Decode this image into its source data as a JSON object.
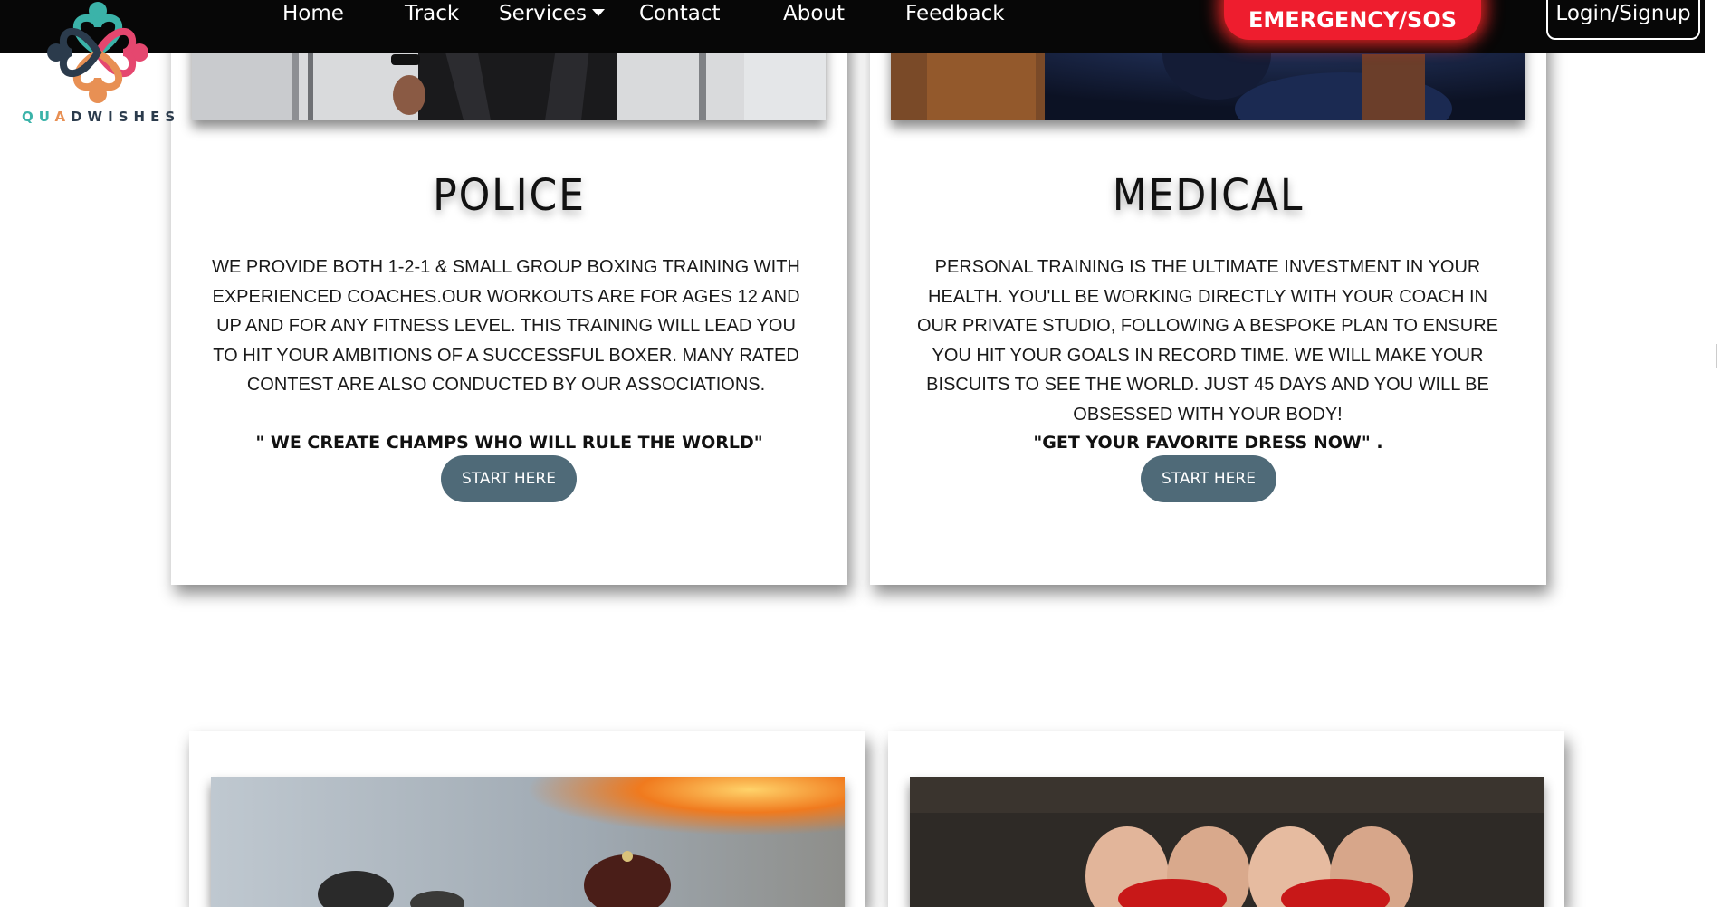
{
  "nav": {
    "items": [
      "Home",
      "Track",
      "Services",
      "Contact",
      "About",
      "Feedback"
    ],
    "sos_label": "EMERGENCY/SOS",
    "login_label": "Login/Signup"
  },
  "logo": {
    "letters": [
      "Q",
      "U",
      "A",
      "D",
      "W",
      "I",
      "S",
      "H",
      "E",
      "S"
    ],
    "letter_colors": [
      "#3bb3a9",
      "#3bb3a9",
      "#e89054",
      "#2b3b4c",
      "#2b3b4c",
      "#2b3b4c",
      "#2b3b4c",
      "#2b3b4c",
      "#2b3b4c",
      "#2b3b4c"
    ],
    "petal_colors": {
      "teal": "#3bb3a9",
      "pink": "#e5476f",
      "orange": "#e89054",
      "navy": "#2b3b4c"
    }
  },
  "cards": [
    {
      "title": "POLICE",
      "description": "WE PROVIDE BOTH 1-2-1 & SMALL GROUP BOXING TRAINING WITH EXPERIENCED COACHES.OUR WORKOUTS ARE FOR AGES 12 AND UP AND FOR ANY FITNESS LEVEL. THIS TRAINING WILL LEAD YOU TO HIT YOUR AMBITIONS OF A SUCCESSFUL BOXER. MANY RATED CONTEST ARE ALSO CONDUCTED BY OUR ASSOCIATIONS.",
      "quote": "\" WE CREATE CHAMPS WHO WILL RULE THE WORLD\"",
      "button": "START HERE"
    },
    {
      "title": "MEDICAL",
      "description": "PERSONAL TRAINING IS THE ULTIMATE INVESTMENT IN YOUR HEALTH. YOU'LL BE WORKING DIRECTLY WITH YOUR COACH IN OUR PRIVATE STUDIO, FOLLOWING A BESPOKE PLAN TO ENSURE YOU HIT YOUR GOALS IN RECORD TIME. WE WILL MAKE YOUR BISCUITS TO SEE THE WORLD. JUST 45 DAYS AND YOU WILL BE OBSESSED WITH YOUR BODY!",
      "quote": "\"GET YOUR FAVORITE DRESS NOW\" .",
      "button": "START HERE"
    }
  ],
  "colors": {
    "navbar": "#070707",
    "sos": "#ee1d2e",
    "button": "#4f6a78"
  }
}
